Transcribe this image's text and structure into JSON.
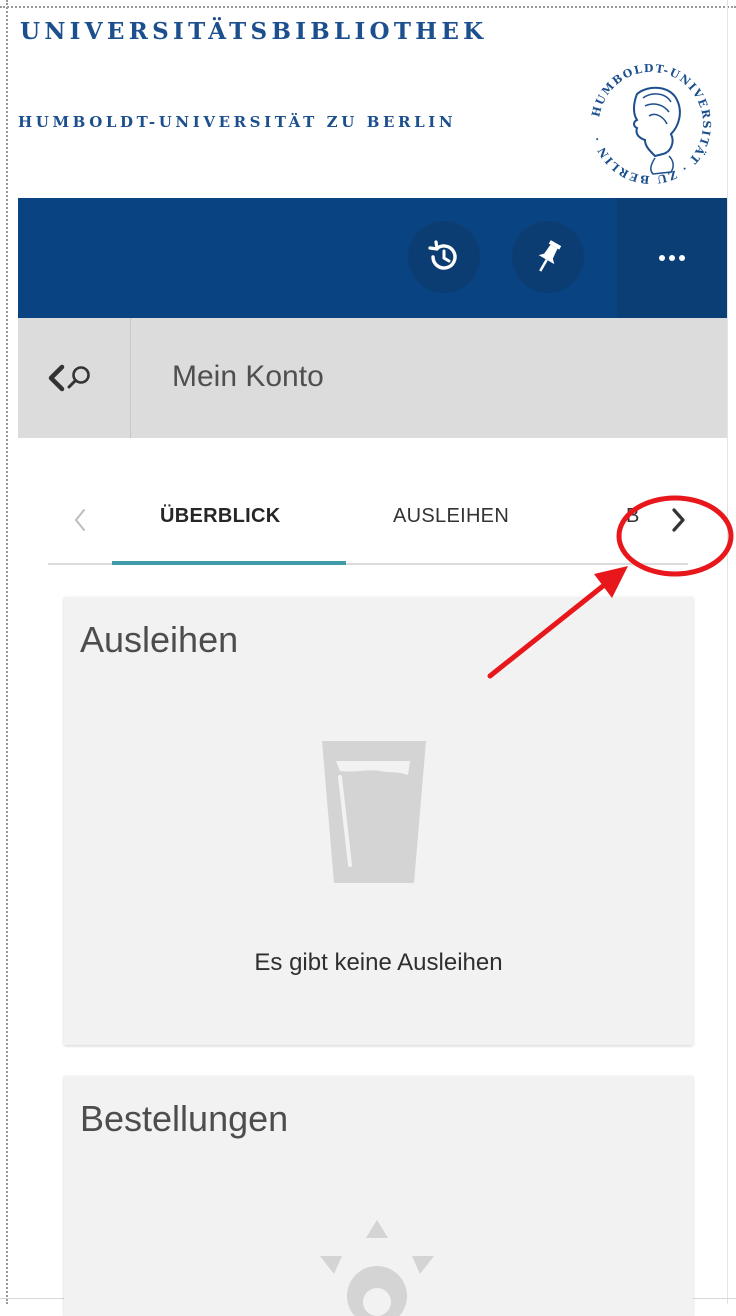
{
  "header": {
    "line1": "UNIVERSITÄTSBIBLIOTHEK",
    "line2": "HUMBOLDT-UNIVERSITÄT ZU BERLIN",
    "seal_text": "HUMBOLDT-UNIVERSITÄT · ZU BERLIN ·",
    "brand_color": "#1c4f8d"
  },
  "toolbar": {
    "color": "#0a4381",
    "buttons": [
      {
        "icon": "history-icon"
      },
      {
        "icon": "pin-icon"
      },
      {
        "icon": "more-icon"
      }
    ]
  },
  "titlebar": {
    "back_icon": "back-search-icon",
    "title": "Mein Konto"
  },
  "tabs": {
    "items": [
      {
        "label": "ÜBERBLICK",
        "active": true
      },
      {
        "label": "AUSLEIHEN",
        "active": false
      },
      {
        "label": "B",
        "active": false
      }
    ],
    "accent": "#3f9ba8"
  },
  "cards": {
    "loans": {
      "title": "Ausleihen",
      "empty_text": "Es gibt keine Ausleihen",
      "icon": "empty-glass-icon"
    },
    "orders": {
      "title": "Bestellungen",
      "icon": "orders-icon"
    }
  },
  "annotation": {
    "color": "#e8171b",
    "shape": "circle-and-arrow"
  }
}
